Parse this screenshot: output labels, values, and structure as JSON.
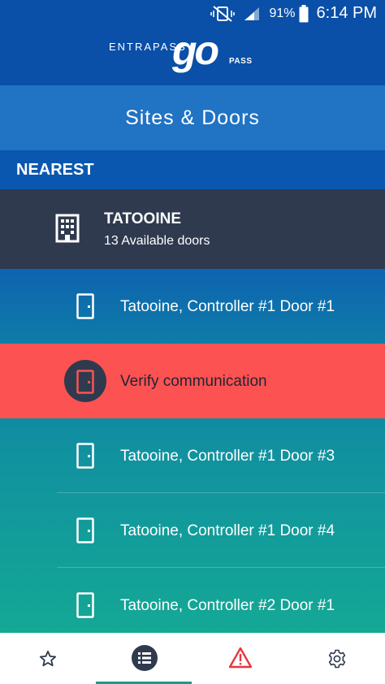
{
  "status_bar": {
    "battery_percent": "91%",
    "time": "6:14 PM",
    "icons": [
      "mute-vibrate-icon",
      "signal-icon",
      "battery-icon"
    ]
  },
  "brand": {
    "entrapass": "ENTRAPASS",
    "go": "go",
    "pass": "PASS"
  },
  "header": {
    "title": "Sites & Doors"
  },
  "section": {
    "label": "NEAREST"
  },
  "site": {
    "name": "TATOOINE",
    "subtitle": "13 Available doors",
    "icon": "building-icon"
  },
  "doors": [
    {
      "label": "Tatooine, Controller #1 Door #1",
      "status": "normal"
    },
    {
      "label": "Verify communication",
      "status": "alert"
    },
    {
      "label": "Tatooine, Controller #1 Door #3",
      "status": "normal"
    },
    {
      "label": "Tatooine, Controller #1 Door #4",
      "status": "normal"
    },
    {
      "label": "Tatooine, Controller #2 Door #1",
      "status": "normal"
    }
  ],
  "bottom_nav": {
    "items": [
      "favorites-icon",
      "list-icon",
      "warning-icon",
      "settings-icon"
    ],
    "active": "list-icon"
  },
  "colors": {
    "primary": "#0a57b0",
    "title_bar": "#2173c4",
    "site_row": "#2f3a4e",
    "alert": "#fd5252",
    "warning": "#e8363e",
    "active_indicator": "#1a9a8c"
  }
}
